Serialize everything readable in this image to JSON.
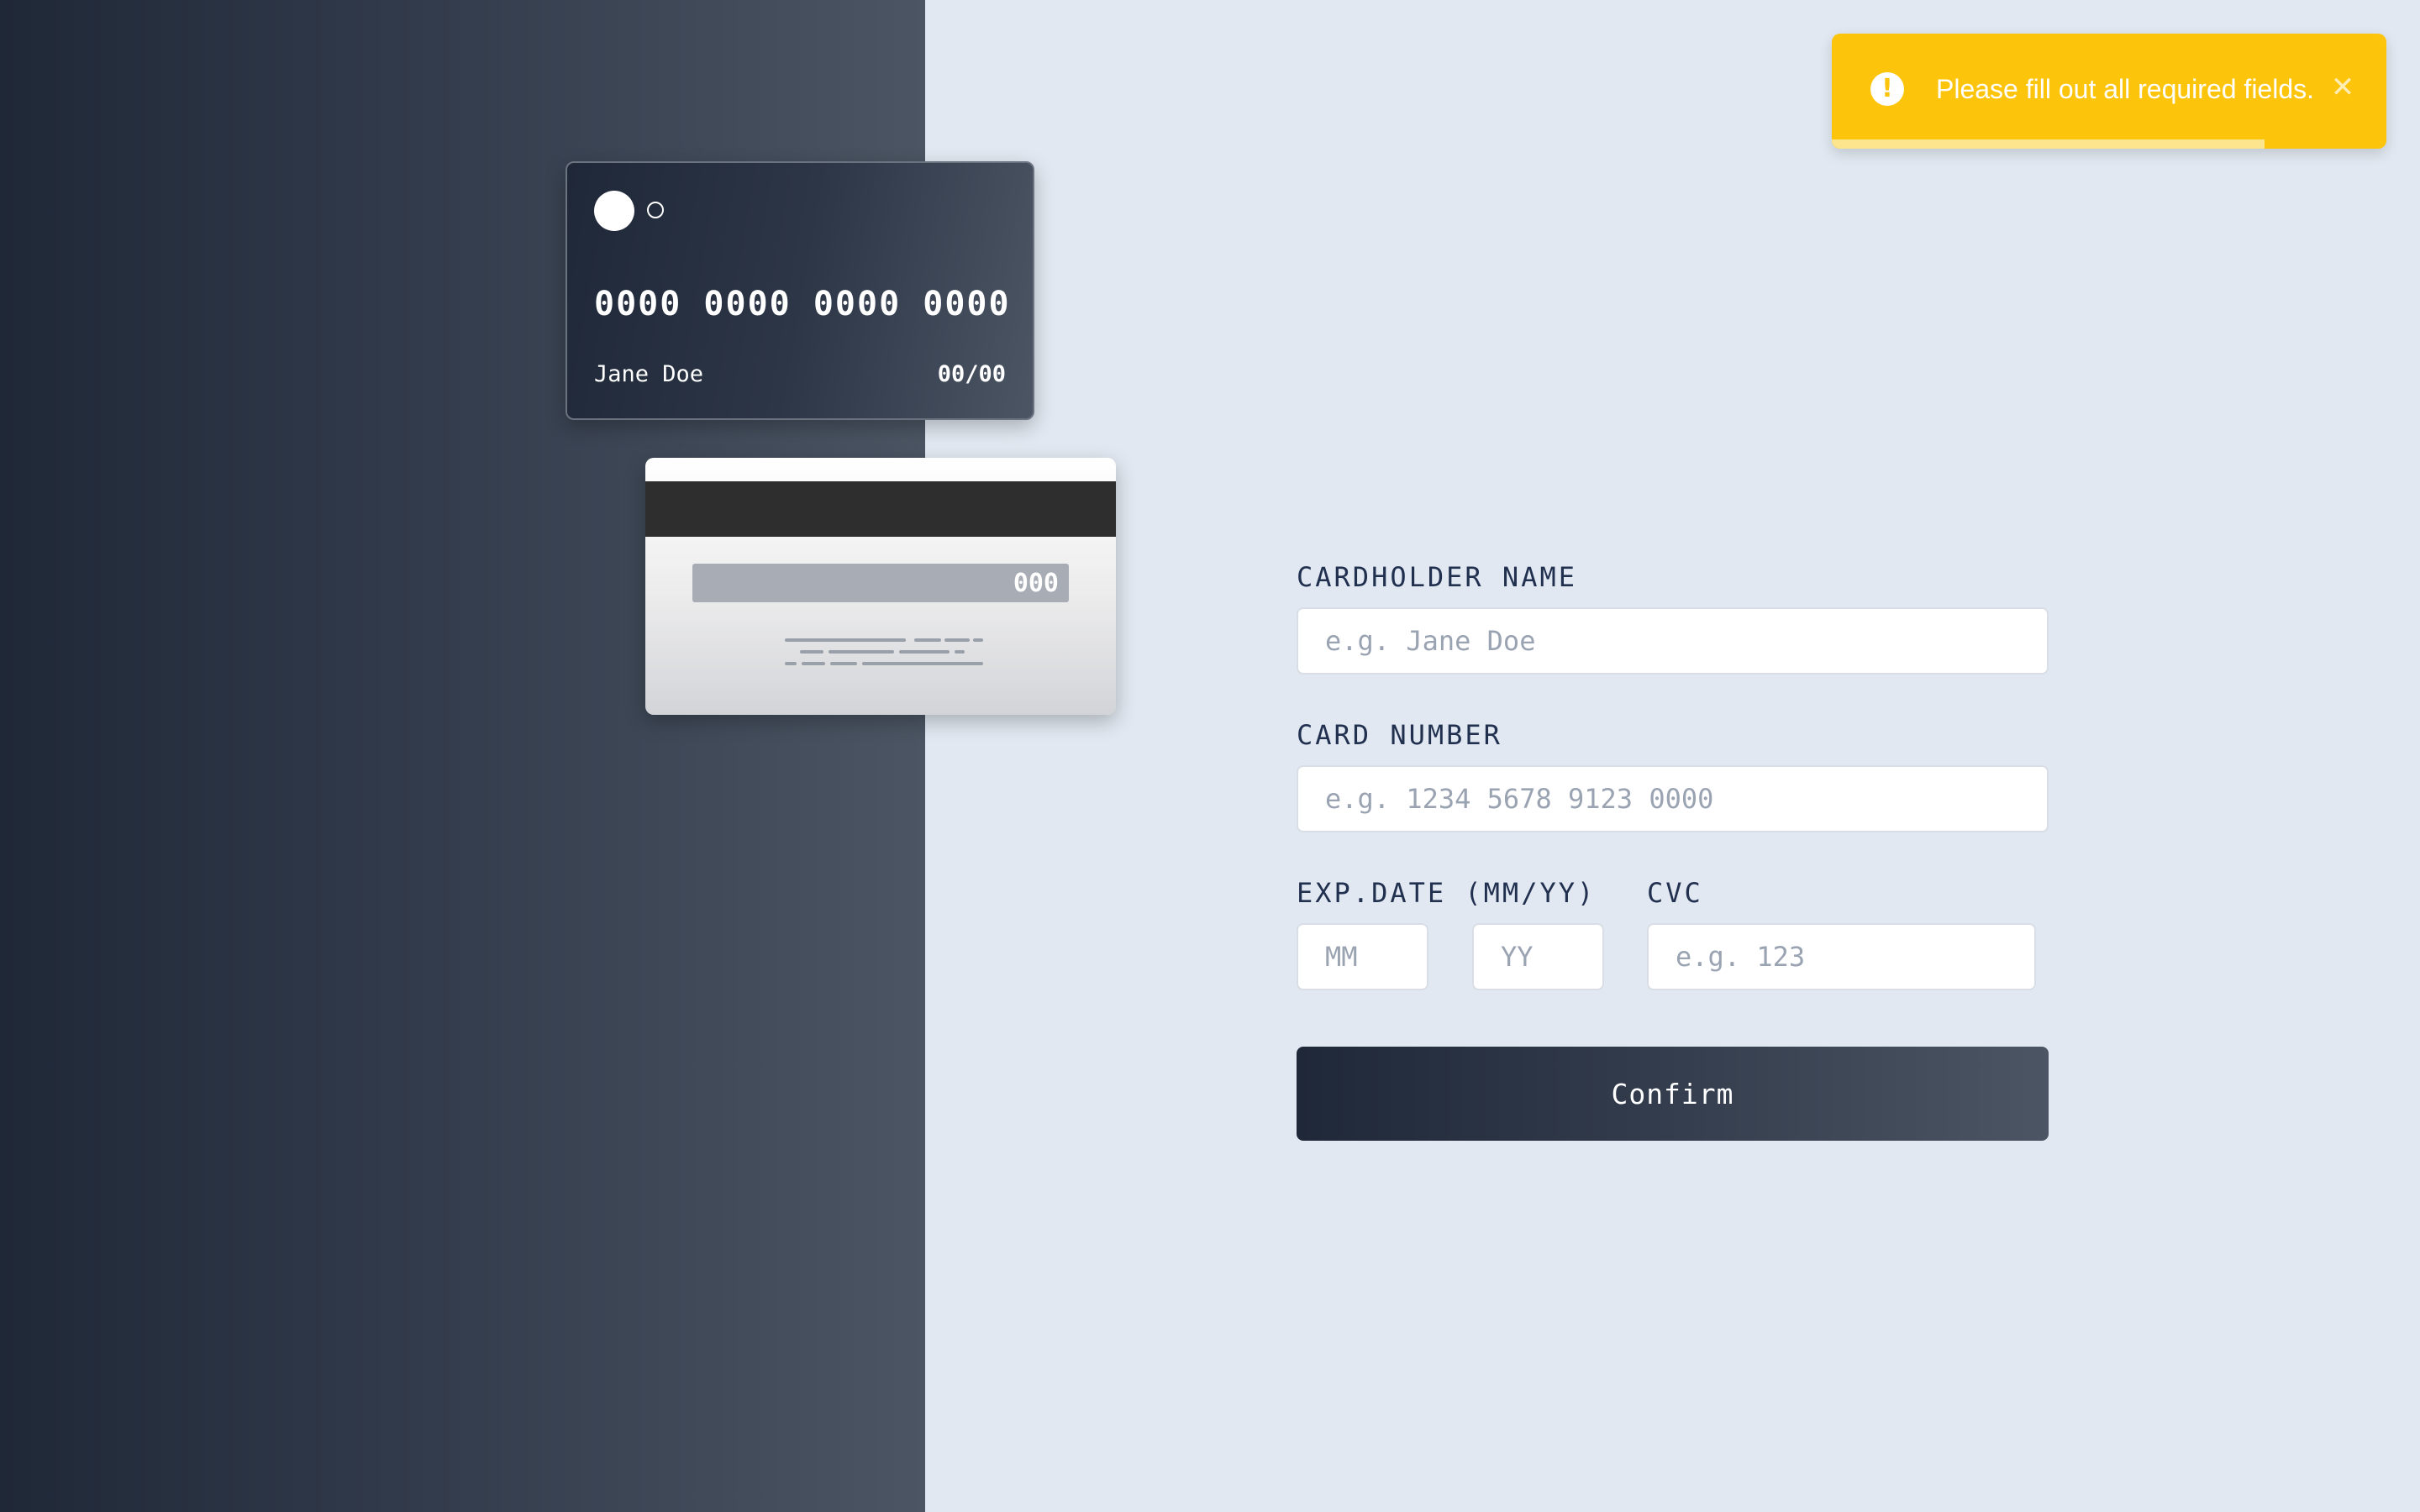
{
  "card_front": {
    "number": "0000 0000 0000 0000",
    "holder": "Jane Doe",
    "expiry": "00/00",
    "logo_icon": "card-brand-circles-icon"
  },
  "card_back": {
    "cvc": "000"
  },
  "form": {
    "name_label": "CARDHOLDER NAME",
    "name_placeholder": "e.g. Jane Doe",
    "name_value": "",
    "number_label": "CARD NUMBER",
    "number_placeholder": "e.g. 1234 5678 9123 0000",
    "number_value": "",
    "expiry_label": "EXP.DATE (MM/YY)",
    "month_placeholder": "MM",
    "month_value": "",
    "year_placeholder": "YY",
    "year_value": "",
    "cvc_label": "CVC",
    "cvc_placeholder": "e.g. 123",
    "cvc_value": "",
    "confirm_label": "Confirm"
  },
  "toast": {
    "icon": "exclamation-circle-icon",
    "icon_glyph": "!",
    "message": "Please fill out all required fields.",
    "close_icon": "close-icon",
    "close_glyph": "✕",
    "progress_remaining": 0.78
  },
  "colors": {
    "left_gradient_start": "#1f2837",
    "left_gradient_end": "#4b5563",
    "background": "#e1e8f1",
    "label_text": "#21304f",
    "toast_background": "#fdc40c"
  }
}
